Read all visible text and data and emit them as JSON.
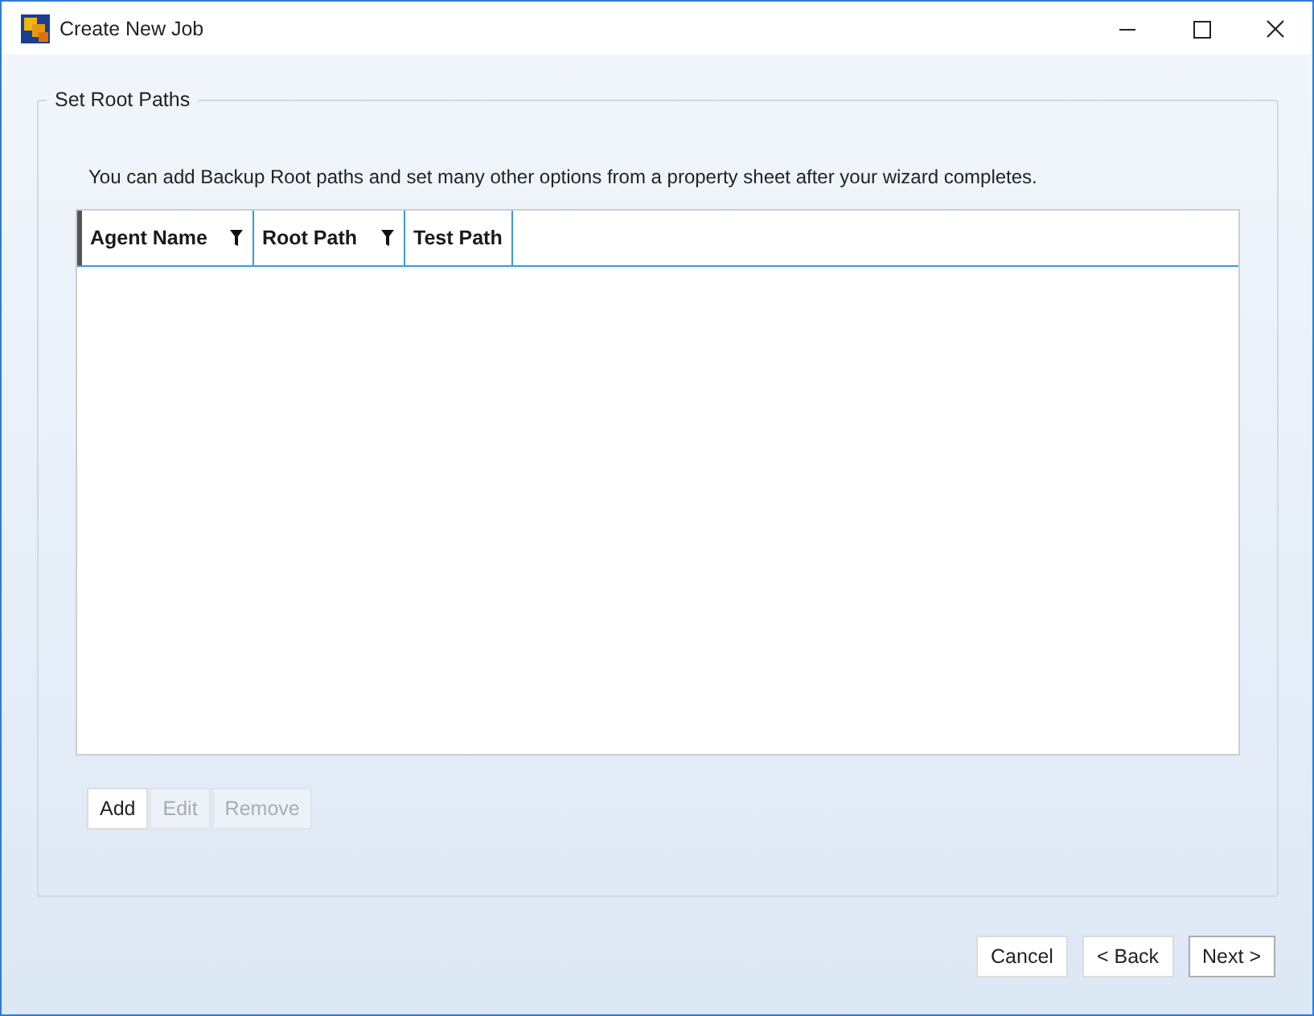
{
  "window": {
    "title": "Create New Job"
  },
  "group": {
    "title": "Set Root Paths",
    "description": "You can add Backup Root paths and set many other options from a property sheet after your wizard completes."
  },
  "table": {
    "columns": [
      {
        "label": "Agent Name",
        "filter": true
      },
      {
        "label": "Root Path",
        "filter": true
      },
      {
        "label": "Test Path",
        "filter": false
      }
    ]
  },
  "row_buttons": [
    {
      "label": "Add",
      "disabled": false
    },
    {
      "label": "Edit",
      "disabled": true
    },
    {
      "label": "Remove",
      "disabled": true
    }
  ],
  "buttons": [
    {
      "label": "Cancel",
      "default": false
    },
    {
      "label": "< Back",
      "default": false
    },
    {
      "label": "Next >",
      "default": true
    }
  ]
}
